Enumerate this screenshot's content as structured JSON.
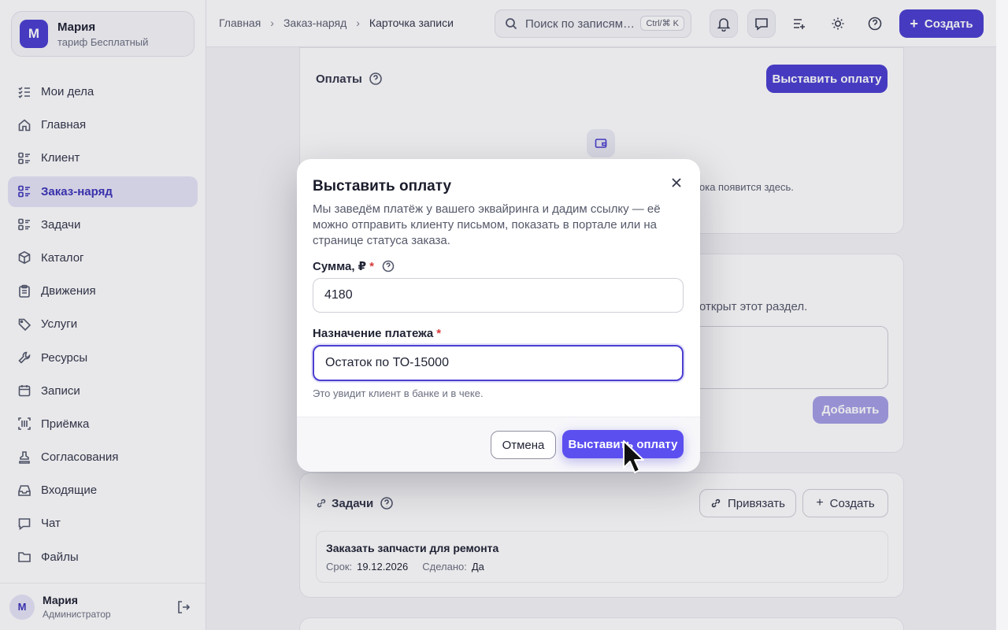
{
  "account": {
    "initial": "М",
    "name": "Мария",
    "plan": "тариф Бесплатный"
  },
  "sidebar": {
    "items": [
      {
        "label": "Мои дела",
        "icon": "list-check-icon"
      },
      {
        "label": "Главная",
        "icon": "home-icon"
      },
      {
        "label": "Клиент",
        "icon": "list-icon"
      },
      {
        "label": "Заказ-наряд",
        "icon": "list-icon",
        "active": true
      },
      {
        "label": "Задачи",
        "icon": "list-icon"
      },
      {
        "label": "Каталог",
        "icon": "box-icon"
      },
      {
        "label": "Движения",
        "icon": "clipboard-icon"
      },
      {
        "label": "Услуги",
        "icon": "tag-icon"
      },
      {
        "label": "Ресурсы",
        "icon": "wrench-icon"
      },
      {
        "label": "Записи",
        "icon": "calendar-icon"
      },
      {
        "label": "Приёмка",
        "icon": "scan-icon"
      },
      {
        "label": "Согласования",
        "icon": "stamp-icon"
      },
      {
        "label": "Входящие",
        "icon": "inbox-icon"
      },
      {
        "label": "Чат",
        "icon": "chat-icon"
      },
      {
        "label": "Файлы",
        "icon": "folder-icon"
      }
    ]
  },
  "user": {
    "initial": "М",
    "name": "Мария",
    "role": "Администратор"
  },
  "topbar": {
    "breadcrumbs": [
      "Главная",
      "Заказ-наряд",
      "Карточка записи"
    ],
    "search_placeholder": "Поиск по записям…",
    "search_shortcut": "Ctrl/⌘ K",
    "create_label": "Создать"
  },
  "payments_card": {
    "title": "Оплаты",
    "action_label": "Выставить оплату",
    "empty_text_visible": "ока появится здесь."
  },
  "notes_card": {
    "text_visible": "открыт этот раздел.",
    "add_label": "Добавить"
  },
  "tasks_card": {
    "title": "Задачи",
    "link_label": "Привязать",
    "create_label": "Создать",
    "task": {
      "title": "Заказать запчасти для ремонта",
      "due_label": "Срок:",
      "due_value": "19.12.2026",
      "done_label": "Сделано:",
      "done_value": "Да"
    }
  },
  "modal": {
    "title": "Выставить оплату",
    "description": "Мы заведём платёж у вашего эквайринга и дадим ссылку — её можно отправить клиенту письмом, показать в портале или на странице статуса заказа.",
    "amount_label": "Сумма, ₽",
    "amount_value": "4180",
    "purpose_label": "Назначение платежа",
    "purpose_value": "Остаток по ТО-15000",
    "required_mark": "*",
    "hint": "Это увидит клиент в банке и в чеке.",
    "cancel_label": "Отмена",
    "submit_label": "Выставить оплату"
  },
  "colors": {
    "accent": "#4b3fd1",
    "required": "#d63a3a"
  }
}
